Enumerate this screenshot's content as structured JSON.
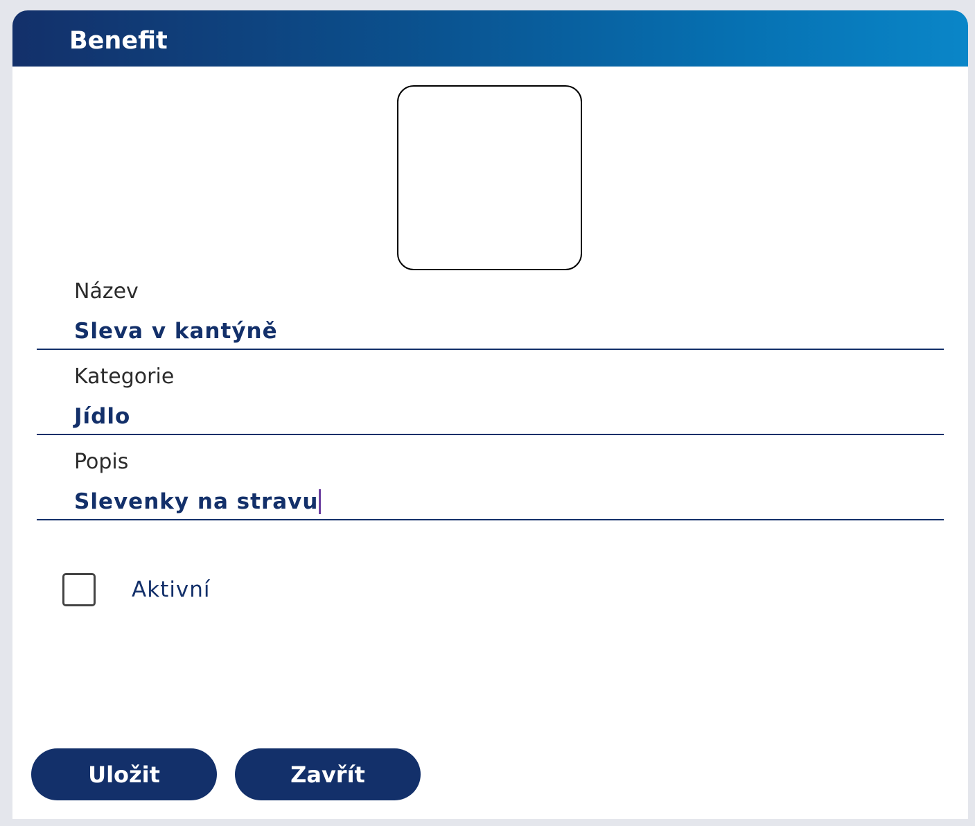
{
  "dialog": {
    "title": "Benefit"
  },
  "form": {
    "fields": [
      {
        "label": "Název",
        "value": "Sleva v kantýně"
      },
      {
        "label": "Kategorie",
        "value": "Jídlo"
      },
      {
        "label": "Popis",
        "value": "Slevenky na stravu"
      }
    ],
    "active": {
      "label": "Aktivní",
      "checked": false
    }
  },
  "actions": {
    "save_label": "Uložit",
    "close_label": "Zavřít"
  },
  "colors": {
    "primary": "#13306a",
    "header_gradient_start": "#13306a",
    "header_gradient_end": "#0a86c8",
    "caret": "#6c3fa0"
  }
}
